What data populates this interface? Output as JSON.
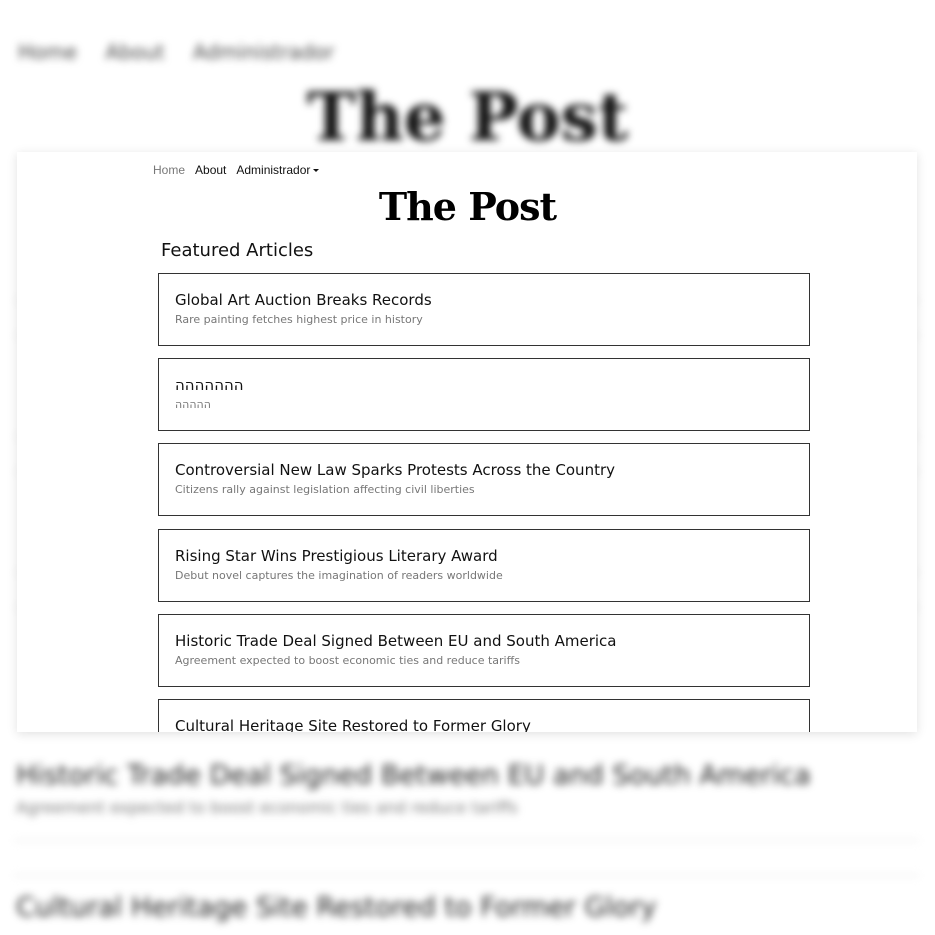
{
  "nav": {
    "home": "Home",
    "about": "About",
    "admin": "Administrador"
  },
  "logo": "The Post",
  "section_title": "Featured Articles",
  "articles": [
    {
      "title": "Global Art Auction Breaks Records",
      "subtitle": "Rare painting fetches highest price in history"
    },
    {
      "title": "ההההההה",
      "subtitle": "ההההה"
    },
    {
      "title": "Controversial New Law Sparks Protests Across the Country",
      "subtitle": "Citizens rally against legislation affecting civil liberties"
    },
    {
      "title": "Rising Star Wins Prestigious Literary Award",
      "subtitle": "Debut novel captures the imagination of readers worldwide"
    },
    {
      "title": "Historic Trade Deal Signed Between EU and South America",
      "subtitle": "Agreement expected to boost economic ties and reduce tariffs"
    },
    {
      "title": "Cultural Heritage Site Restored to Former Glory",
      "subtitle": ""
    }
  ],
  "background": {
    "title_a": "Historic Trade Deal Signed Between EU and South America",
    "sub_a": "Agreement expected to boost economic ties and reduce tariffs",
    "title_b": "Cultural Heritage Site Restored to Former Glory"
  }
}
